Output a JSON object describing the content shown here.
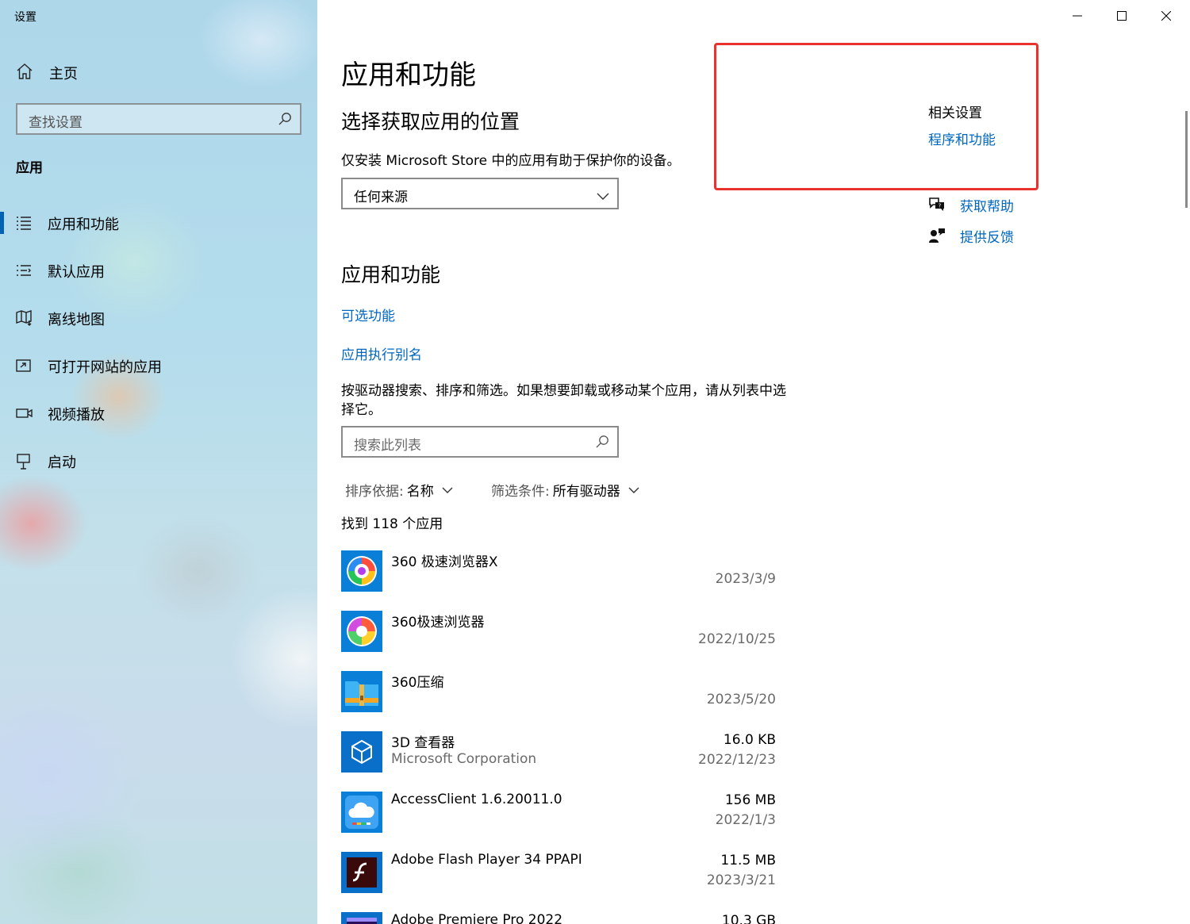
{
  "window": {
    "title": "设置"
  },
  "sidebar": {
    "home_label": "主页",
    "search_placeholder": "查找设置",
    "section_title": "应用",
    "items": [
      {
        "label": "应用和功能",
        "icon": "apps-features-icon",
        "active": true
      },
      {
        "label": "默认应用",
        "icon": "default-apps-icon",
        "active": false
      },
      {
        "label": "离线地图",
        "icon": "offline-maps-icon",
        "active": false
      },
      {
        "label": "可打开网站的应用",
        "icon": "apps-for-websites-icon",
        "active": false
      },
      {
        "label": "视频播放",
        "icon": "video-playback-icon",
        "active": false
      },
      {
        "label": "启动",
        "icon": "startup-icon",
        "active": false
      }
    ]
  },
  "main": {
    "page_title": "应用和功能",
    "install_section": {
      "heading": "选择获取应用的位置",
      "description": "仅安装 Microsoft Store 中的应用有助于保护你的设备。",
      "dropdown_value": "任何来源"
    },
    "apps_section": {
      "heading": "应用和功能",
      "optional_features_link": "可选功能",
      "app_alias_link": "应用执行别名",
      "description": "按驱动器搜索、排序和筛选。如果想要卸载或移动某个应用，请从列表中选择它。",
      "search_placeholder": "搜索此列表",
      "sort_label": "排序依据:",
      "sort_value": "名称",
      "filter_label": "筛选条件:",
      "filter_value": "所有驱动器",
      "found_count": "找到 118 个应用",
      "apps": [
        {
          "name": "360 极速浏览器X",
          "publisher": "",
          "size": "",
          "date": "2023/3/9",
          "icon": "360-browser-x-icon"
        },
        {
          "name": "360极速浏览器",
          "publisher": "",
          "size": "",
          "date": "2022/10/25",
          "icon": "360-browser-icon"
        },
        {
          "name": "360压缩",
          "publisher": "",
          "size": "",
          "date": "2023/5/20",
          "icon": "360-zip-icon"
        },
        {
          "name": "3D 查看器",
          "publisher": "Microsoft Corporation",
          "size": "16.0 KB",
          "date": "2022/12/23",
          "icon": "3d-viewer-icon"
        },
        {
          "name": "AccessClient 1.6.20011.0",
          "publisher": "",
          "size": "156 MB",
          "date": "2022/1/3",
          "icon": "accessclient-icon"
        },
        {
          "name": "Adobe Flash Player 34 PPAPI",
          "publisher": "",
          "size": "11.5 MB",
          "date": "2023/3/21",
          "icon": "flash-player-icon"
        },
        {
          "name": "Adobe Premiere Pro 2022",
          "publisher": "",
          "size": "10.3 GB",
          "date": "",
          "icon": "premiere-pro-icon"
        }
      ]
    }
  },
  "related": {
    "title": "相关设置",
    "programs_link": "程序和功能",
    "get_help": "获取帮助",
    "give_feedback": "提供反馈"
  },
  "colors": {
    "accent": "#0067c0",
    "highlight_border": "#e8322e",
    "nav_indicator": "#0063b1"
  }
}
